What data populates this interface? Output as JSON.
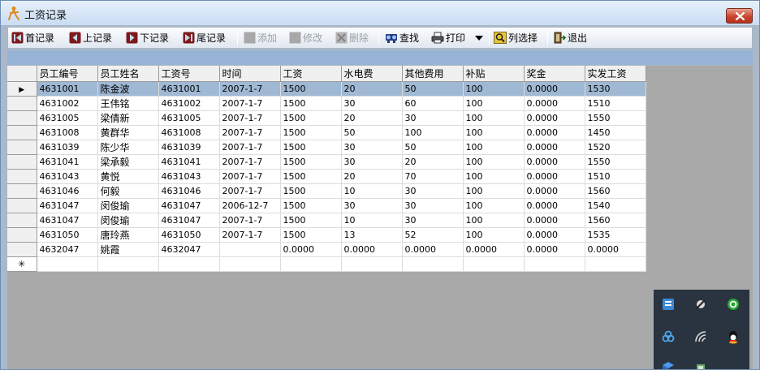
{
  "window": {
    "title": "工资记录"
  },
  "toolbar": {
    "first": "首记录",
    "prev": "上记录",
    "next": "下记录",
    "last": "尾记录",
    "add": "添加",
    "edit": "修改",
    "delete": "删除",
    "search": "查找",
    "print": "打印",
    "columns": "列选择",
    "exit": "退出"
  },
  "grid": {
    "columns": [
      "员工编号",
      "员工姓名",
      "工资号",
      "时间",
      "工资",
      "水电费",
      "其他费用",
      "补贴",
      "奖金",
      "实发工资"
    ],
    "rows": [
      [
        "4631001",
        "陈金波",
        "4631001",
        "2007-1-7",
        "1500",
        "20",
        "50",
        "100",
        "0.0000",
        "1530"
      ],
      [
        "4631002",
        "王伟铭",
        "4631002",
        "2007-1-7",
        "1500",
        "30",
        "60",
        "100",
        "0.0000",
        "1510"
      ],
      [
        "4631005",
        "梁倩新",
        "4631005",
        "2007-1-7",
        "1500",
        "20",
        "30",
        "100",
        "0.0000",
        "1550"
      ],
      [
        "4631008",
        "黄群华",
        "4631008",
        "2007-1-7",
        "1500",
        "50",
        "100",
        "100",
        "0.0000",
        "1450"
      ],
      [
        "4631039",
        "陈少华",
        "4631039",
        "2007-1-7",
        "1500",
        "30",
        "50",
        "100",
        "0.0000",
        "1520"
      ],
      [
        "4631041",
        "梁承毅",
        "4631041",
        "2007-1-7",
        "1500",
        "30",
        "20",
        "100",
        "0.0000",
        "1550"
      ],
      [
        "4631043",
        "黄悦",
        "4631043",
        "2007-1-7",
        "1500",
        "20",
        "70",
        "100",
        "0.0000",
        "1510"
      ],
      [
        "4631046",
        "何毅",
        "4631046",
        "2007-1-7",
        "1500",
        "10",
        "30",
        "100",
        "0.0000",
        "1560"
      ],
      [
        "4631047",
        "闵俊瑜",
        "4631047",
        "2006-12-7",
        "1500",
        "30",
        "30",
        "100",
        "0.0000",
        "1540"
      ],
      [
        "4631047",
        "闵俊瑜",
        "4631047",
        "2007-1-7",
        "1500",
        "10",
        "30",
        "100",
        "0.0000",
        "1560"
      ],
      [
        "4631050",
        "唐玲燕",
        "4631050",
        "2007-1-7",
        "1500",
        "13",
        "52",
        "100",
        "0.0000",
        "1535"
      ],
      [
        "4632047",
        "姚霞",
        "4632047",
        "",
        "0.0000",
        "0.0000",
        "0.0000",
        "0.0000",
        "0.0000",
        "0.0000"
      ]
    ],
    "selected_row": 0,
    "current_marker": "▶",
    "new_row_marker": "✳"
  },
  "colors": {
    "selection": "#9fb8d3",
    "group_bar": "#97b4d6",
    "grid_bg": "#a9a9a9"
  },
  "icons": [
    "app-person-icon",
    "close-icon",
    "first-record-icon",
    "prev-record-icon",
    "next-record-icon",
    "last-record-icon",
    "add-icon",
    "edit-icon",
    "delete-icon",
    "search-icon",
    "print-icon",
    "dropdown-arrow-icon",
    "column-select-icon",
    "exit-icon"
  ]
}
